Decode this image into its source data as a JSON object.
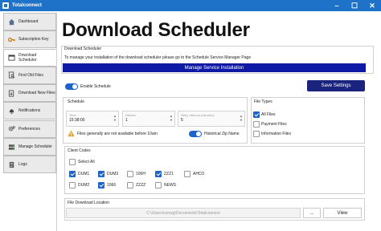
{
  "window": {
    "title": "Totalconnect"
  },
  "sidebar": {
    "items": [
      {
        "label": "Dashboard"
      },
      {
        "label": "Subscription Key"
      },
      {
        "label": "Download Scheduler"
      },
      {
        "label": "Find Old Files"
      },
      {
        "label": "Download New Files"
      },
      {
        "label": "Notifications"
      },
      {
        "label": "Preferences"
      },
      {
        "label": "Manage Scheduler"
      },
      {
        "label": "Logs"
      }
    ]
  },
  "page": {
    "title": "Download Scheduler"
  },
  "scheduler_group": {
    "label": "Download Scheduler",
    "message": "To manage your installation of the download scheduler please go to the Schedule Service Manager Page",
    "manage_button": "Manage Service Installation"
  },
  "enable_schedule": {
    "label": "Enable Schedule",
    "on": true
  },
  "save_button": "Save Settings",
  "schedule": {
    "label": "Schedule",
    "time": {
      "label": "Time",
      "value": "15:38:00"
    },
    "retries": {
      "label": "Retries",
      "value": "1"
    },
    "retry_interval": {
      "label": "Retry Interval (minutes)",
      "value": "5"
    },
    "warning": "Files generally are not available before 10am",
    "historical_zip": {
      "label": "Historical Zip Name",
      "on": true
    }
  },
  "file_types": {
    "label": "File Types",
    "items": [
      {
        "label": "All Files",
        "checked": true
      },
      {
        "label": "Payment Files",
        "checked": false
      },
      {
        "label": "Information Files",
        "checked": false
      }
    ]
  },
  "client_codes": {
    "label": "Client Codes",
    "select_all": {
      "label": "Select All",
      "checked": false
    },
    "codes": [
      {
        "label": "DUM1",
        "checked": true
      },
      {
        "label": "DUM3",
        "checked": true
      },
      {
        "label": "106H",
        "checked": false
      },
      {
        "label": "ZZZ1",
        "checked": true
      },
      {
        "label": "AHCO",
        "checked": false
      },
      {
        "label": "DUM2",
        "checked": false
      },
      {
        "label": "1066",
        "checked": true
      },
      {
        "label": "ZZZZ",
        "checked": false
      },
      {
        "label": "NEWS",
        "checked": false
      }
    ]
  },
  "download_location": {
    "label": "File Download Location",
    "path": "C:\\Users\\conwg\\Documents\\Totalconnect",
    "browse_label": "...",
    "view_label": "View"
  },
  "colors": {
    "accent": "#1e73c9",
    "primary_button": "#0e1aa6",
    "save_button": "#1a237e"
  }
}
